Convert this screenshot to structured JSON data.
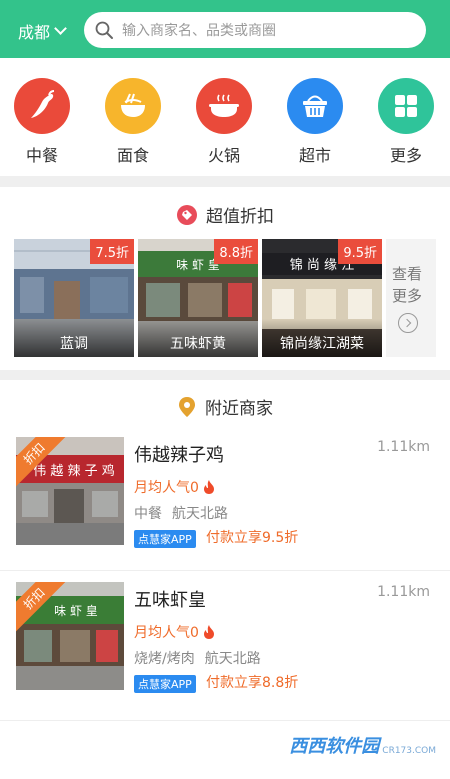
{
  "header": {
    "city": "成都",
    "search_placeholder": "输入商家名、品类或商圈"
  },
  "categories": [
    {
      "label": "中餐",
      "icon": "chili-pepper-icon",
      "color": "#ea4a3a"
    },
    {
      "label": "面食",
      "icon": "noodle-bowl-icon",
      "color": "#f7b52c"
    },
    {
      "label": "火锅",
      "icon": "hotpot-icon",
      "color": "#ea4a3a"
    },
    {
      "label": "超市",
      "icon": "shopping-basket-icon",
      "color": "#2b8bf0"
    },
    {
      "label": "更多",
      "icon": "grid-icon",
      "color": "#2fc49a"
    }
  ],
  "discount_section": {
    "title": "超值折扣",
    "deals": [
      {
        "name": "蓝调",
        "badge": "7.5折"
      },
      {
        "name": "五味虾黄",
        "badge": "8.8折"
      },
      {
        "name": "锦尚缘江湖菜",
        "badge": "9.5折"
      }
    ],
    "more_label": "查看更多"
  },
  "nearby_section": {
    "title": "附近商家",
    "shops": [
      {
        "tag": "折扣",
        "name": "伟越辣子鸡",
        "distance": "1.11km",
        "popularity": "月均人气0",
        "category": "中餐",
        "area": "航天北路",
        "app_badge": "点慧家APP",
        "pay_text": "付款立享9.5折"
      },
      {
        "tag": "折扣",
        "name": "五味虾皇",
        "distance": "1.11km",
        "popularity": "月均人气0",
        "category": "烧烤/烤肉",
        "area": "航天北路",
        "app_badge": "点慧家APP",
        "pay_text": "付款立享8.8折"
      }
    ]
  },
  "watermark": {
    "text": "西西软件园",
    "sub": "CR173.COM"
  },
  "colors": {
    "brand": "#33c38b",
    "badge_red": "#ea4d3c",
    "accent_orange": "#ef6b2a",
    "app_blue": "#2b8bf0"
  }
}
